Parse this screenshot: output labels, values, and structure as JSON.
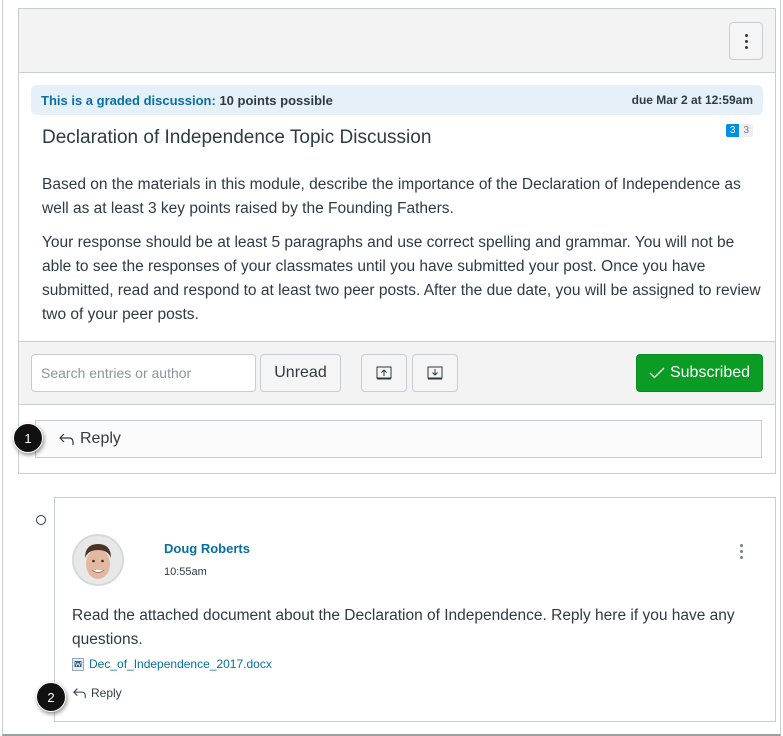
{
  "topic": {
    "menu_icon": "kebab-vertical-icon",
    "graded_label": "This is a graded discussion:",
    "points": "10 points possible",
    "due_date": "due Mar 2 at 12:59am",
    "title": "Declaration of Independence Topic Discussion",
    "unread_count": "3",
    "total_count": "3",
    "body": [
      "Based on the materials in this module, describe the importance of the Declaration of Independence as well as at least 3 key points raised by the Founding Fathers.",
      "Your response should be at least 5 paragraphs and use correct spelling and grammar. You will not be able to see the responses of your classmates until you have submitted your post. Once you have submitted, read and respond to at least two peer posts. After the due date, you will be assigned to review two of your peer posts."
    ]
  },
  "toolbar": {
    "search_placeholder": "Search entries or author",
    "search_value": "",
    "unread_label": "Unread",
    "collapse_icon": "collapse-all-icon",
    "expand_icon": "expand-all-icon",
    "subscribed_label": "Subscribed",
    "subscribed_color": "#0b9c24"
  },
  "reply": {
    "label": "Reply",
    "icon": "reply-arrow-icon"
  },
  "callouts": [
    "1",
    "2"
  ],
  "entry": {
    "author": "Doug Roberts",
    "time": "10:55am",
    "message": "Read the attached document about the Declaration of Independence. Reply here if you have any questions.",
    "attachment": "Dec_of_Independence_2017.docx",
    "reply_label": "Reply"
  },
  "colors": {
    "link": "#0770a3",
    "banner_bg": "#e5f0f8",
    "badge_blue": "#008ee2"
  }
}
